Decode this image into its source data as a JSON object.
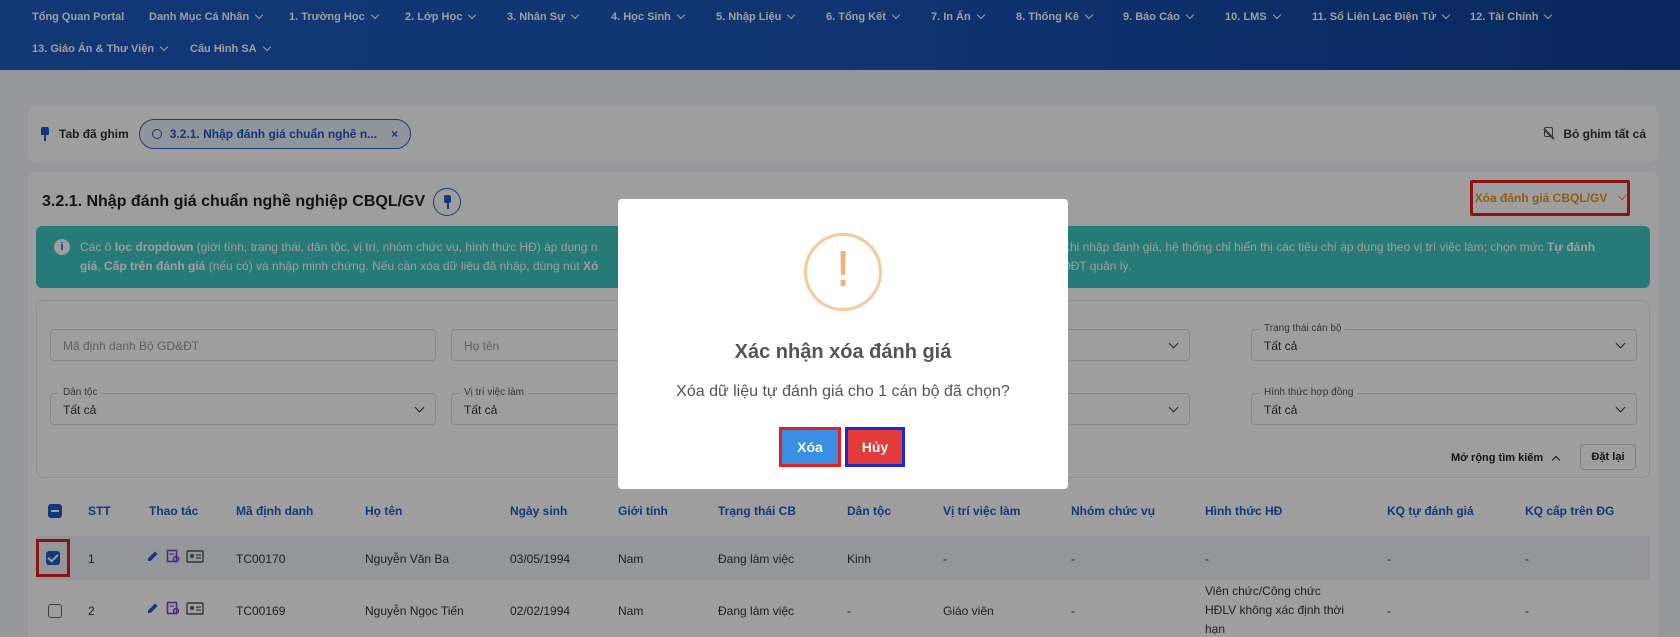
{
  "nav": {
    "items": [
      {
        "label": "Tổng Quan Portal",
        "chevron": false
      },
      {
        "label": "Danh Mục Cá Nhân",
        "chevron": true
      },
      {
        "label": "1. Trường Học",
        "chevron": true
      },
      {
        "label": "2. Lớp Học",
        "chevron": true
      },
      {
        "label": "3. Nhân Sự",
        "chevron": true
      },
      {
        "label": "4. Học Sinh",
        "chevron": true
      },
      {
        "label": "5. Nhập Liệu",
        "chevron": true
      },
      {
        "label": "6. Tổng Kết",
        "chevron": true
      },
      {
        "label": "7. In Ấn",
        "chevron": true
      },
      {
        "label": "8. Thống Kê",
        "chevron": true
      },
      {
        "label": "9. Báo Cáo",
        "chevron": true
      },
      {
        "label": "10. LMS",
        "chevron": true
      },
      {
        "label": "11. Sổ Liên Lạc Điện Tử",
        "chevron": true
      },
      {
        "label": "12. Tài Chính",
        "chevron": true
      },
      {
        "label": "13. Giáo Án & Thư Viện",
        "chevron": true
      },
      {
        "label": "Cấu Hình SA",
        "chevron": true
      }
    ]
  },
  "pinbar": {
    "label": "Tab đã ghim",
    "chip_label": "3.2.1. Nhập đánh giá chuẩn nghề n...",
    "chip_close": "×",
    "unpin_all": "Bỏ ghim tất cả"
  },
  "panel": {
    "title": "3.2.1. Nhập đánh giá chuẩn nghề nghiệp CBQL/GV",
    "delete_button": "Xóa đánh giá CBQL/GV"
  },
  "info": {
    "icon": "i",
    "line1_a": "Các ô ",
    "line1_b": "lọc dropdown",
    "line1_c": " (giới tính, trạng thái, dân tộc, vị trí, nhóm chức vụ, hình thức HĐ) áp dụng n",
    "line1_d": "Khi nhập đánh giá, hệ thống chỉ hiển thị các tiêu chí áp dụng theo vị trí việc làm; chọn mức ",
    "line1_e": "Tự đánh",
    "line2_a": "giá",
    "line2_b": ", ",
    "line2_c": "Cấp trên đánh giá",
    "line2_d": " (nếu có) và nhập minh chứng. Nếu cần xóa dữ liệu đã nhập, dùng nút ",
    "line2_e": "Xó",
    "line2_f": "ĐĐT quản lý."
  },
  "filters": {
    "id_placeholder": "Mã định danh Bộ GD&ĐT",
    "name_placeholder": "Họ tên",
    "status_label": "Trạng thái cán bộ",
    "status_value": "Tất cả",
    "ethnic_label": "Dân tộc",
    "ethnic_value": "Tất cả",
    "position_label": "Vị trí việc làm",
    "position_value": "Tất cả",
    "contract_label": "Hình thức hợp đồng",
    "contract_value": "Tất cả",
    "expand_label": "Mở rộng tìm kiếm",
    "reset_label": "Đặt lại"
  },
  "table": {
    "columns": [
      "STT",
      "Thao tác",
      "Mã định danh",
      "Họ tên",
      "Ngày sinh",
      "Giới tính",
      "Trạng thái CB",
      "Dân tộc",
      "Vị trí việc làm",
      "Nhóm chức vụ",
      "Hình thức HĐ",
      "KQ tự đánh giá",
      "KQ cấp trên ĐG"
    ],
    "rows": [
      {
        "stt": "1",
        "id": "TC00170",
        "name": "Nguyễn Văn Ba",
        "dob": "03/05/1994",
        "gender": "Nam",
        "status": "Đang làm việc",
        "ethnic": "Kinh",
        "position": "-",
        "group": "-",
        "contract": "-",
        "self": "-",
        "sup": "-"
      },
      {
        "stt": "2",
        "id": "TC00169",
        "name": "Nguyễn Ngọc Tiến",
        "dob": "02/02/1994",
        "gender": "Nam",
        "status": "Đang làm việc",
        "ethnic": "-",
        "position": "Giáo viên",
        "group": "-",
        "contract_1": "Viên chức/Công chức",
        "contract_2": "HĐLV không xác định thời",
        "contract_3": "hạn",
        "self": "-",
        "sup": "-"
      }
    ]
  },
  "modal": {
    "icon": "!",
    "title": "Xác nhận xóa đánh giá",
    "text": "Xóa dữ liệu tự đánh giá cho 1 cán bộ đã chọn?",
    "confirm": "Xóa",
    "cancel": "Hủy"
  },
  "colors": {
    "nav_bg": "#1a56b8",
    "accent": "#1e5bc6",
    "info_bg": "#3ec7c2",
    "warn": "#f6b078",
    "delete_text": "#e59520",
    "confirm_bg": "#3b8ee5",
    "cancel_bg": "#e33a3a"
  }
}
